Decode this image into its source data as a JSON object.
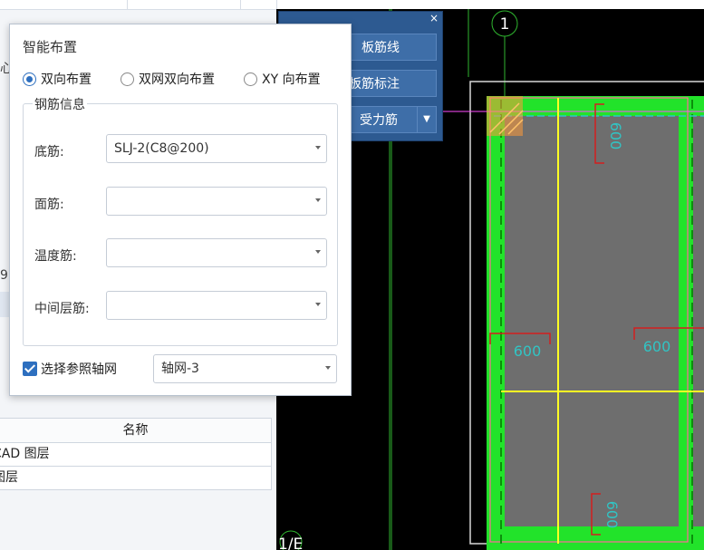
{
  "left_panel": {
    "partial_chars": [
      "心",
      "9"
    ],
    "table": {
      "header": "名称",
      "rows": [
        "CAD 图层",
        "图层"
      ]
    }
  },
  "floating_toolbar": {
    "close": "×",
    "buttons": [
      "板筋线",
      "板筋标注",
      "受力筋"
    ]
  },
  "dialog": {
    "title": "智能布置",
    "layout_options": [
      {
        "label": "双向布置",
        "checked": true
      },
      {
        "label": "双网双向布置",
        "checked": false
      },
      {
        "label": "XY 向布置",
        "checked": false
      }
    ],
    "group_title": "钢筋信息",
    "fields": [
      {
        "label": "底筋:",
        "value": "SLJ-2(C8@200)"
      },
      {
        "label": "面筋:",
        "value": ""
      },
      {
        "label": "温度筋:",
        "value": ""
      },
      {
        "label": "中间层筋:",
        "value": ""
      }
    ],
    "axis_checkbox": {
      "label": "选择参照轴网",
      "checked": true
    },
    "axis_select": {
      "value": "轴网-3"
    }
  },
  "cad": {
    "axis_top": "1",
    "axis_bottom": "1/E",
    "dims": [
      "600",
      "600",
      "600",
      "600"
    ],
    "colors": {
      "green": "#22e32a",
      "gray": "#6e6e6e",
      "yellow": "#ffff24",
      "red": "#d41e1e",
      "cyan": "#31c4c4",
      "magenta": "#ff4cff"
    }
  }
}
